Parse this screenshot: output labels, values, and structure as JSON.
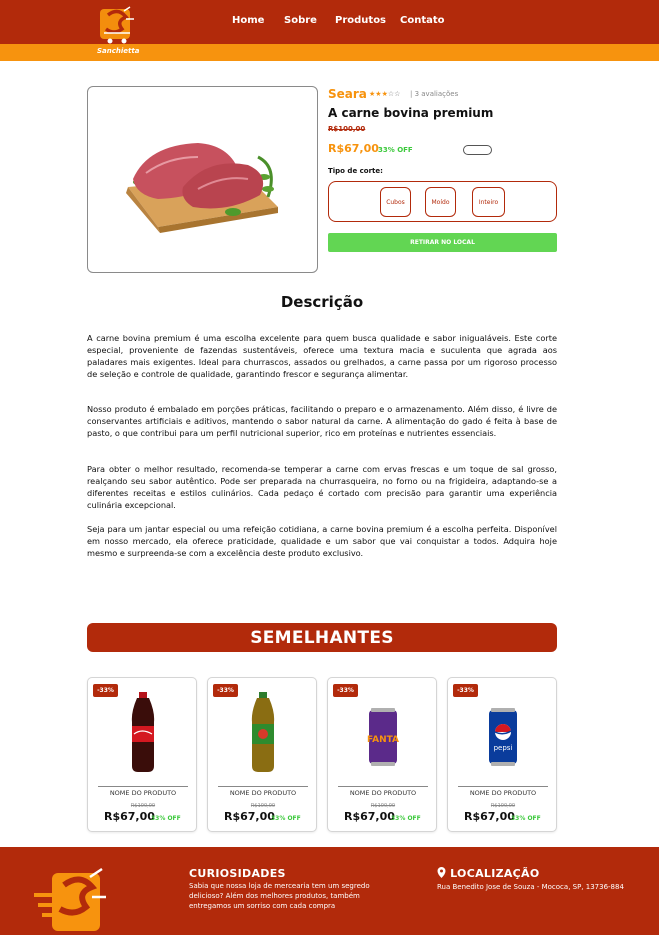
{
  "header": {
    "logo_text": "Sanchietta",
    "nav": [
      "Home",
      "Sobre",
      "Produtos",
      "Contato"
    ]
  },
  "product": {
    "brand": "Seara",
    "rating": {
      "stars_filled": 3,
      "stars_total": 5,
      "reviews_text": "| 3 avaliações"
    },
    "name": "A carne bovina premium",
    "old_price": "R$100,00",
    "price": "R$67,00",
    "discount": "33% OFF",
    "cut_label": "Tipo de corte:",
    "cut_options": [
      "Cubos",
      "Moído",
      "Inteiro"
    ],
    "pickup_button": "RETIRAR NO LOCAL"
  },
  "description": {
    "title": "Descrição",
    "paragraphs": [
      "A carne bovina premium é uma escolha excelente para quem busca qualidade e sabor inigualáveis. Este corte especial, proveniente de fazendas sustentáveis, oferece uma textura macia e suculenta que agrada aos paladares mais exigentes. Ideal para churrascos, assados ou grelhados, a carne passa por um rigoroso processo de seleção e controle de qualidade, garantindo frescor e segurança alimentar.",
      "Nosso produto é embalado em porções práticas, facilitando o preparo e o armazenamento. Além disso, é livre de conservantes artificiais e aditivos, mantendo o sabor natural da carne. A alimentação do gado é feita à base de pasto, o que contribui para um perfil nutricional superior, rico em proteínas e nutrientes essenciais.",
      "Para obter o melhor resultado, recomenda-se temperar a carne com ervas frescas e um toque de sal grosso, realçando seu sabor autêntico. Pode ser preparada na churrasqueira, no forno ou na frigideira, adaptando-se a diferentes receitas e estilos culinários. Cada pedaço é cortado com precisão para garantir uma experiência culinária excepcional.",
      "Seja para um jantar especial ou uma refeição cotidiana, a carne bovina premium é a escolha perfeita. Disponível em nosso mercado, ela oferece praticidade, qualidade e um sabor que vai conquistar a todos. Adquira hoje mesmo e surpreenda-se com a excelência deste produto exclusivo."
    ]
  },
  "similar": {
    "title": "SEMELHANTES",
    "items": [
      {
        "badge": "-33%",
        "name": "NOME DO PRODUTO",
        "old_price": "R$100,00",
        "price": "R$67,00",
        "discount": "33% OFF",
        "image": "coca-cola-bottle",
        "color": "#c4121a"
      },
      {
        "badge": "-33%",
        "name": "NOME DO PRODUTO",
        "old_price": "R$100,00",
        "price": "R$67,00",
        "discount": "33% OFF",
        "image": "guarana-bottle",
        "color": "#2e8b2e"
      },
      {
        "badge": "-33%",
        "name": "NOME DO PRODUTO",
        "old_price": "R$100,00",
        "price": "R$67,00",
        "discount": "33% OFF",
        "image": "fanta-can",
        "color": "#5b2a8a"
      },
      {
        "badge": "-33%",
        "name": "NOME DO PRODUTO",
        "old_price": "R$100,00",
        "price": "R$67,00",
        "discount": "33% OFF",
        "image": "pepsi-can",
        "color": "#0a3c9c"
      }
    ]
  },
  "footer": {
    "curiosities_title": "CURIOSIDADES",
    "curiosities_text": "Sabia que nossa loja de mercearia tem um segredo delicioso? Além dos melhores produtos, também entregamos um sorriso com cada compra",
    "location_title": "LOCALIZAÇÃO",
    "location_text": "Rua Benedito Jose de Souza - Mococa, SP, 13736-884"
  },
  "colors": {
    "brand_red": "#b22a0b",
    "brand_orange": "#f7930e",
    "success_green": "#62d653"
  }
}
